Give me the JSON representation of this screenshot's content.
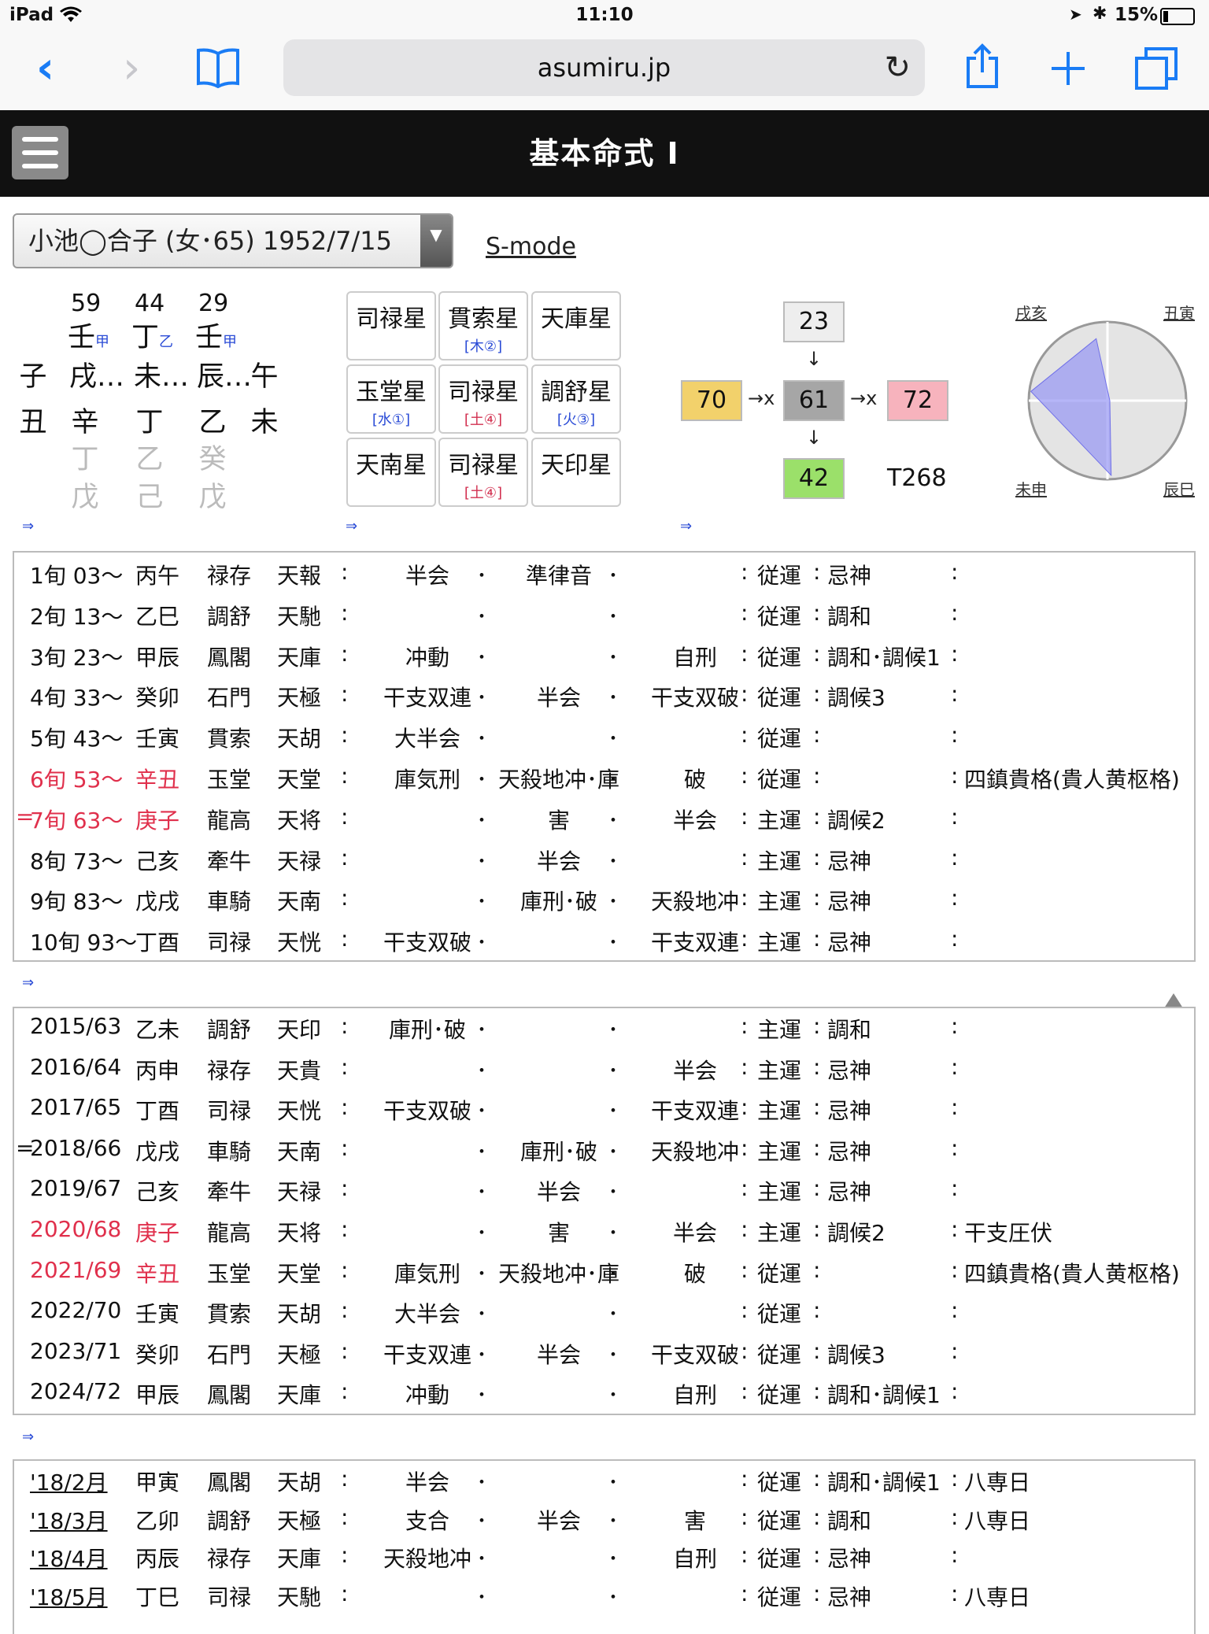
{
  "status_bar": {
    "device": "iPad",
    "time": "11:10",
    "battery": "15%"
  },
  "browser": {
    "url": "asumiru.jp"
  },
  "header": {
    "title": "基本命式 Ⅰ"
  },
  "selector": {
    "value": "小池◯合子 (女･65) 1952/7/15",
    "smode": "S-mode"
  },
  "meishiki": {
    "numbers": [
      "59",
      "44",
      "29"
    ],
    "stems": [
      {
        "k": "壬",
        "s": "甲"
      },
      {
        "k": "丁",
        "s": "乙"
      },
      {
        "k": "壬",
        "s": "甲"
      }
    ],
    "row2": [
      "子",
      "戌…",
      "未…",
      "辰…",
      "午"
    ],
    "row3": [
      "丑",
      "辛",
      "丁",
      "乙",
      "未"
    ],
    "row4": [
      "丁",
      "乙",
      "癸"
    ],
    "row5": [
      "戊",
      "己",
      "戊"
    ]
  },
  "stars": [
    {
      "name": "司禄星",
      "el": "",
      "c": ""
    },
    {
      "name": "貫索星",
      "el": "[木②]",
      "c": "b"
    },
    {
      "name": "天庫星",
      "el": "",
      "c": ""
    },
    {
      "name": "玉堂星",
      "el": "[水①]",
      "c": "b"
    },
    {
      "name": "司禄星",
      "el": "[土④]",
      "c": "r"
    },
    {
      "name": "調舒星",
      "el": "[火③]",
      "c": "b"
    },
    {
      "name": "天南星",
      "el": "",
      "c": ""
    },
    {
      "name": "司禄星",
      "el": "[土④]",
      "c": "r"
    },
    {
      "name": "天印星",
      "el": "",
      "c": ""
    }
  ],
  "energy": {
    "top": "23",
    "left": "70",
    "center": "61",
    "right": "72",
    "bottom": "42",
    "total": "T268",
    "arrow_x": "→x",
    "down": "↓"
  },
  "energy_colors": {
    "left": "#f2d16b",
    "center": "#a6a6a6",
    "right": "#f7b3bd",
    "bottom": "#9be06a",
    "top": "#eeeeee"
  },
  "quadrants": {
    "tl": "戌亥",
    "tr": "丑寅",
    "bl": "未申",
    "br": "辰巳"
  },
  "radar": {
    "vertices": [
      {
        "v": 0.8
      },
      {
        "v": 0.03
      },
      {
        "v": 0.98
      },
      {
        "v": 0.95
      }
    ]
  },
  "nav_arrow": "⇒",
  "taiun": [
    {
      "m": "",
      "n": "1旬 03〜",
      "k": "丙午",
      "s1": "禄存",
      "s2": "天報",
      "c1": "半会",
      "c2": "準律音",
      "c3": "",
      "u": "従運",
      "f": "忌神",
      "x": "",
      "red": false
    },
    {
      "m": "",
      "n": "2旬 13〜",
      "k": "乙巳",
      "s1": "調舒",
      "s2": "天馳",
      "c1": "",
      "c2": "",
      "c3": "",
      "u": "従運",
      "f": "調和",
      "x": "",
      "red": false
    },
    {
      "m": "",
      "n": "3旬 23〜",
      "k": "甲辰",
      "s1": "鳳閣",
      "s2": "天庫",
      "c1": "冲動",
      "c2": "",
      "c3": "自刑",
      "u": "従運",
      "f": "調和･調候1",
      "x": "",
      "red": false
    },
    {
      "m": "",
      "n": "4旬 33〜",
      "k": "癸卯",
      "s1": "石門",
      "s2": "天極",
      "c1": "干支双連",
      "c2": "半会",
      "c3": "干支双破",
      "u": "従運",
      "f": "調候3",
      "x": "",
      "red": false
    },
    {
      "m": "",
      "n": "5旬 43〜",
      "k": "壬寅",
      "s1": "貫索",
      "s2": "天胡",
      "c1": "大半会",
      "c2": "",
      "c3": "",
      "u": "従運",
      "f": "",
      "x": "",
      "red": false
    },
    {
      "m": "",
      "n": "6旬 53〜",
      "k": "辛丑",
      "s1": "玉堂",
      "s2": "天堂",
      "c1": "庫気刑",
      "c2": "天殺地冲･庫",
      "c3": "破",
      "u": "従運",
      "f": "",
      "x": "四鎮貴格(貴人黄枢格)",
      "red": true
    },
    {
      "m": "=",
      "n": "7旬 63〜",
      "k": "庚子",
      "s1": "龍高",
      "s2": "天将",
      "c1": "",
      "c2": "害",
      "c3": "半会",
      "u": "主運",
      "f": "調候2",
      "x": "",
      "red": true
    },
    {
      "m": "",
      "n": "8旬 73〜",
      "k": "己亥",
      "s1": "牽牛",
      "s2": "天禄",
      "c1": "",
      "c2": "半会",
      "c3": "",
      "u": "主運",
      "f": "忌神",
      "x": "",
      "red": false
    },
    {
      "m": "",
      "n": "9旬 83〜",
      "k": "戊戌",
      "s1": "車騎",
      "s2": "天南",
      "c1": "",
      "c2": "庫刑･破",
      "c3": "天殺地冲",
      "u": "主運",
      "f": "忌神",
      "x": "",
      "red": false
    },
    {
      "m": "",
      "n": "10旬 93〜",
      "k": "丁酉",
      "s1": "司禄",
      "s2": "天恍",
      "c1": "干支双破",
      "c2": "",
      "c3": "干支双連",
      "u": "主運",
      "f": "忌神",
      "x": "",
      "red": false
    }
  ],
  "nenun": [
    {
      "m": "",
      "n": "2015/63",
      "k": "乙未",
      "s1": "調舒",
      "s2": "天印",
      "c1": "庫刑･破",
      "c2": "",
      "c3": "",
      "u": "主運",
      "f": "調和",
      "x": "",
      "red": false
    },
    {
      "m": "",
      "n": "2016/64",
      "k": "丙申",
      "s1": "禄存",
      "s2": "天貴",
      "c1": "",
      "c2": "",
      "c3": "半会",
      "u": "主運",
      "f": "忌神",
      "x": "",
      "red": false
    },
    {
      "m": "",
      "n": "2017/65",
      "k": "丁酉",
      "s1": "司禄",
      "s2": "天恍",
      "c1": "干支双破",
      "c2": "",
      "c3": "干支双連",
      "u": "主運",
      "f": "忌神",
      "x": "",
      "red": false
    },
    {
      "m": "=",
      "n": "2018/66",
      "k": "戊戌",
      "s1": "車騎",
      "s2": "天南",
      "c1": "",
      "c2": "庫刑･破",
      "c3": "天殺地冲",
      "u": "主運",
      "f": "忌神",
      "x": "",
      "red": false
    },
    {
      "m": "",
      "n": "2019/67",
      "k": "己亥",
      "s1": "牽牛",
      "s2": "天禄",
      "c1": "",
      "c2": "半会",
      "c3": "",
      "u": "主運",
      "f": "忌神",
      "x": "",
      "red": false
    },
    {
      "m": "",
      "n": "2020/68",
      "k": "庚子",
      "s1": "龍高",
      "s2": "天将",
      "c1": "",
      "c2": "害",
      "c3": "半会",
      "u": "主運",
      "f": "調候2",
      "x": "干支圧伏",
      "red": true
    },
    {
      "m": "",
      "n": "2021/69",
      "k": "辛丑",
      "s1": "玉堂",
      "s2": "天堂",
      "c1": "庫気刑",
      "c2": "天殺地冲･庫",
      "c3": "破",
      "u": "従運",
      "f": "",
      "x": "四鎮貴格(貴人黄枢格)",
      "red": true
    },
    {
      "m": "",
      "n": "2022/70",
      "k": "壬寅",
      "s1": "貫索",
      "s2": "天胡",
      "c1": "大半会",
      "c2": "",
      "c3": "",
      "u": "従運",
      "f": "",
      "x": "",
      "red": false
    },
    {
      "m": "",
      "n": "2023/71",
      "k": "癸卯",
      "s1": "石門",
      "s2": "天極",
      "c1": "干支双連",
      "c2": "半会",
      "c3": "干支双破",
      "u": "従運",
      "f": "調候3",
      "x": "",
      "red": false
    },
    {
      "m": "",
      "n": "2024/72",
      "k": "甲辰",
      "s1": "鳳閣",
      "s2": "天庫",
      "c1": "冲動",
      "c2": "",
      "c3": "自刑",
      "u": "従運",
      "f": "調和･調候1",
      "x": "",
      "red": false
    }
  ],
  "getsuun": [
    {
      "n": "'18/2月",
      "k": "甲寅",
      "s1": "鳳閣",
      "s2": "天胡",
      "c1": "半会",
      "c2": "",
      "c3": "",
      "u": "従運",
      "f": "調和･調候1",
      "x": "八専日"
    },
    {
      "n": "'18/3月",
      "k": "乙卯",
      "s1": "調舒",
      "s2": "天極",
      "c1": "支合",
      "c2": "半会",
      "c3": "害",
      "u": "従運",
      "f": "調和",
      "x": "八専日"
    },
    {
      "n": "'18/4月",
      "k": "丙辰",
      "s1": "禄存",
      "s2": "天庫",
      "c1": "天殺地冲",
      "c2": "",
      "c3": "自刑",
      "u": "従運",
      "f": "忌神",
      "x": ""
    },
    {
      "n": "'18/5月",
      "k": "丁巳",
      "s1": "司禄",
      "s2": "天馳",
      "c1": "",
      "c2": "",
      "c3": "",
      "u": "従運",
      "f": "忌神",
      "x": "八専日"
    }
  ]
}
